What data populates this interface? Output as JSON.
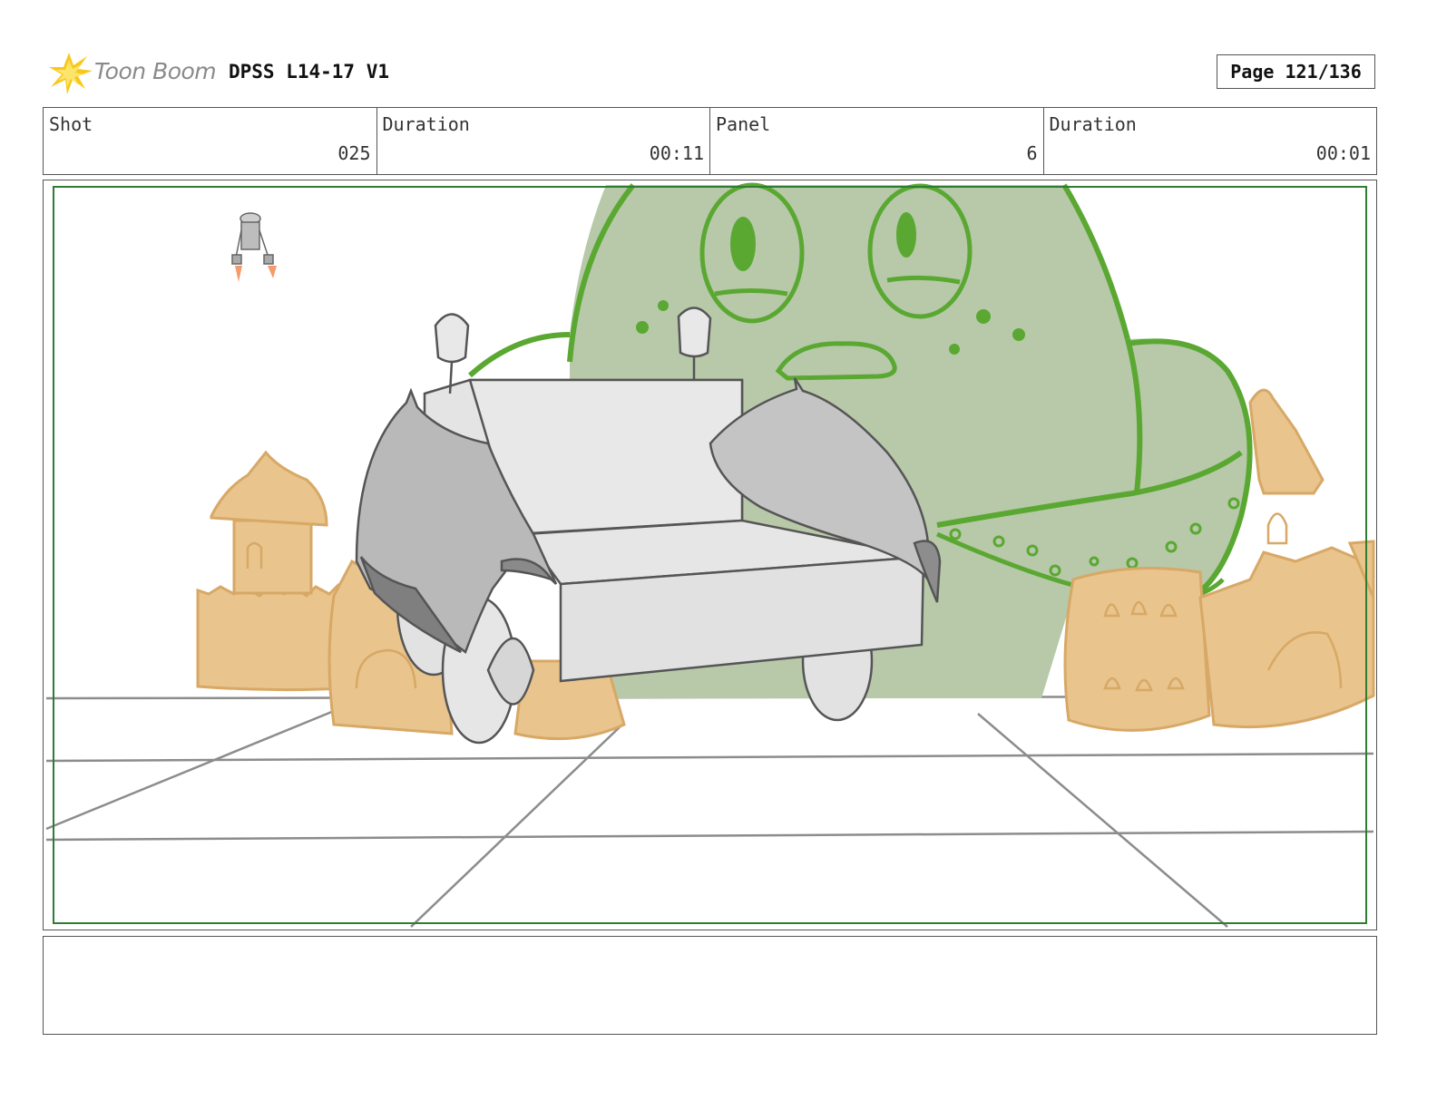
{
  "header": {
    "logo_text": "Toon Boom",
    "project_title": "DPSS L14-17 V1",
    "page_label": "Page 121/136"
  },
  "info": [
    {
      "label": "Shot",
      "value": "025"
    },
    {
      "label": "Duration",
      "value": "00:11"
    },
    {
      "label": "Panel",
      "value": "6"
    },
    {
      "label": "Duration",
      "value": "00:01"
    }
  ],
  "notes": "",
  "colors": {
    "safe_frame": "#2e7d32",
    "monster_fill": "#b7c9a9",
    "monster_line": "#5aa832",
    "sand": "#e9c48c",
    "sand_line": "#d7a866"
  }
}
